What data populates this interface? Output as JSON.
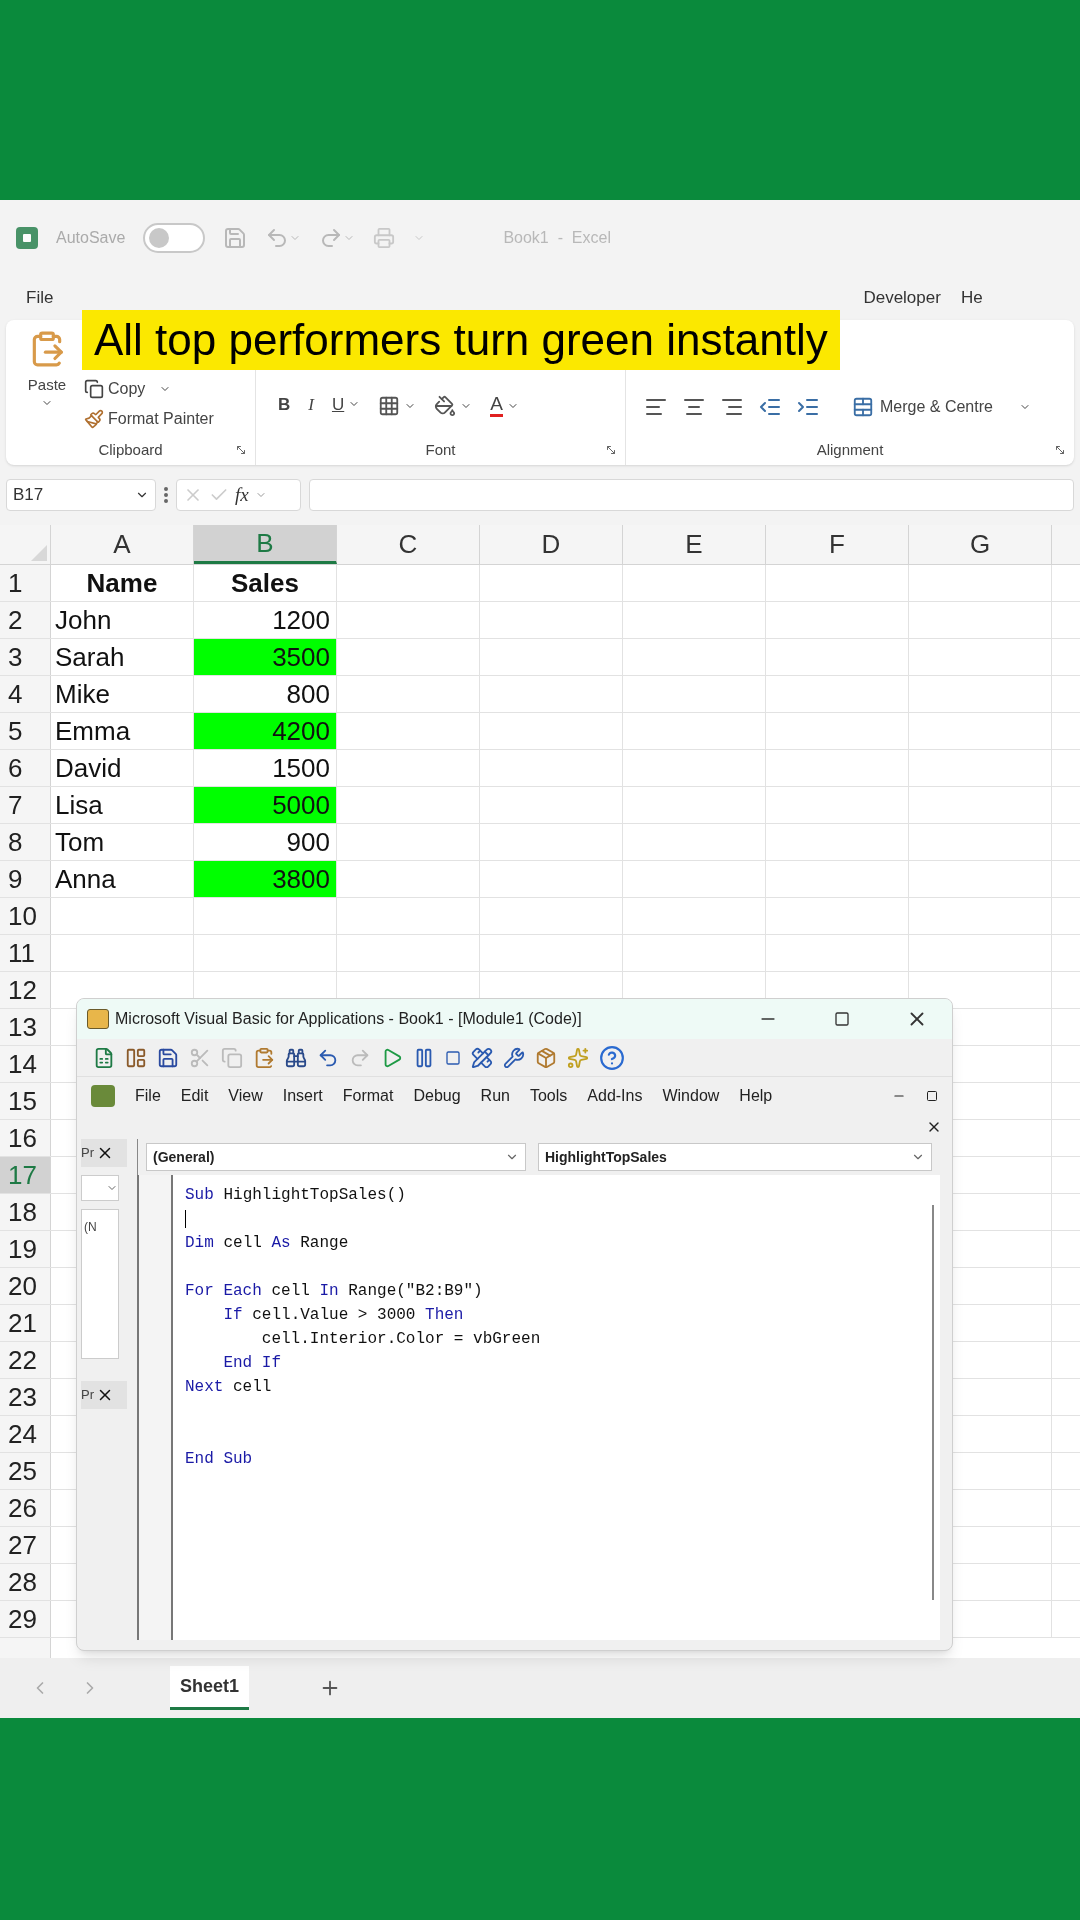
{
  "excel": {
    "app_title": "Book1  -  Excel",
    "autosave": {
      "label": "AutoSave",
      "on": false
    },
    "tabs": [
      "File",
      "Developer",
      "He"
    ],
    "caption": "All top performers turn green instantly",
    "ribbon": {
      "clipboard": {
        "paste": "Paste",
        "copy": "Copy",
        "format_painter": "Format Painter",
        "label": "Clipboard"
      },
      "font": {
        "bold": "B",
        "italic": "I",
        "underline": "U",
        "font_color": "A",
        "label": "Font"
      },
      "alignment": {
        "merge": "Merge & Centre",
        "label": "Alignment"
      }
    },
    "formula_bar": {
      "name_box": "B17",
      "fx": "fx"
    },
    "columns": [
      {
        "label": "A",
        "selected": false
      },
      {
        "label": "B",
        "selected": true
      },
      {
        "label": "C",
        "selected": false
      },
      {
        "label": "D",
        "selected": false
      },
      {
        "label": "E",
        "selected": false
      },
      {
        "label": "F",
        "selected": false
      },
      {
        "label": "G",
        "selected": false
      }
    ],
    "row_numbers": [
      {
        "label": "1",
        "selected": false
      },
      {
        "label": "2",
        "selected": false
      },
      {
        "label": "3",
        "selected": false
      },
      {
        "label": "4",
        "selected": false
      },
      {
        "label": "5",
        "selected": false
      },
      {
        "label": "6",
        "selected": false
      },
      {
        "label": "7",
        "selected": false
      },
      {
        "label": "8",
        "selected": false
      },
      {
        "label": "9",
        "selected": false
      },
      {
        "label": "10",
        "selected": false
      },
      {
        "label": "11",
        "selected": false
      },
      {
        "label": "12",
        "selected": false
      },
      {
        "label": "13",
        "selected": false
      },
      {
        "label": "14",
        "selected": false
      },
      {
        "label": "15",
        "selected": false
      },
      {
        "label": "16",
        "selected": false
      },
      {
        "label": "17",
        "selected": true
      },
      {
        "label": "18",
        "selected": false
      },
      {
        "label": "19",
        "selected": false
      },
      {
        "label": "20",
        "selected": false
      },
      {
        "label": "21",
        "selected": false
      },
      {
        "label": "22",
        "selected": false
      },
      {
        "label": "23",
        "selected": false
      },
      {
        "label": "24",
        "selected": false
      },
      {
        "label": "25",
        "selected": false
      },
      {
        "label": "26",
        "selected": false
      },
      {
        "label": "27",
        "selected": false
      },
      {
        "label": "28",
        "selected": false
      },
      {
        "label": "29",
        "selected": false
      }
    ],
    "table": {
      "header": [
        "Name",
        "Sales"
      ],
      "rows": [
        {
          "name": "John",
          "sales": "1200",
          "highlighted": false
        },
        {
          "name": "Sarah",
          "sales": "3500",
          "highlighted": true
        },
        {
          "name": "Mike",
          "sales": "800",
          "highlighted": false
        },
        {
          "name": "Emma",
          "sales": "4200",
          "highlighted": true
        },
        {
          "name": "David",
          "sales": "1500",
          "highlighted": false
        },
        {
          "name": "Lisa",
          "sales": "5000",
          "highlighted": true
        },
        {
          "name": "Tom",
          "sales": "900",
          "highlighted": false
        },
        {
          "name": "Anna",
          "sales": "3800",
          "highlighted": true
        }
      ]
    },
    "sheets": [
      {
        "label": "Sheet1",
        "selected": true
      }
    ]
  },
  "vba": {
    "title": "Microsoft Visual Basic for Applications - Book1 - [Module1 (Code)]",
    "menu": [
      "File",
      "Edit",
      "View",
      "Insert",
      "Format",
      "Debug",
      "Run",
      "Tools",
      "Add-Ins",
      "Window",
      "Help"
    ],
    "project_pane": {
      "title": "Pr",
      "list_item": "(N"
    },
    "properties_pane": {
      "title": "Pr"
    },
    "object_dropdown": "(General)",
    "procedure_dropdown": "HighlightTopSales",
    "code": [
      {
        "kind": "code",
        "tokens": [
          {
            "text": "Sub",
            "keyword": true
          },
          {
            "text": "HighlightTopSales()",
            "keyword": false
          }
        ]
      },
      {
        "kind": "cursor"
      },
      {
        "kind": "code",
        "tokens": [
          {
            "text": "Dim",
            "keyword": true
          },
          {
            "text": "cell",
            "keyword": false
          },
          {
            "text": "As",
            "keyword": true
          },
          {
            "text": "Range",
            "keyword": false
          }
        ]
      },
      {
        "kind": "blank"
      },
      {
        "kind": "code",
        "tokens": [
          {
            "text": "For Each",
            "keyword": true
          },
          {
            "text": "cell",
            "keyword": false
          },
          {
            "text": "In",
            "keyword": true
          },
          {
            "text": "Range(\"B2:B9\")",
            "keyword": false
          }
        ]
      },
      {
        "kind": "code",
        "tokens": [
          {
            "text": "    If",
            "keyword": true
          },
          {
            "text": "cell.Value > 3000",
            "keyword": false
          },
          {
            "text": "Then",
            "keyword": true
          }
        ]
      },
      {
        "kind": "code",
        "tokens": [
          {
            "text": "        cell.Interior.Color = vbGreen",
            "keyword": false
          }
        ]
      },
      {
        "kind": "code",
        "tokens": [
          {
            "text": "    End If",
            "keyword": true
          }
        ]
      },
      {
        "kind": "code",
        "tokens": [
          {
            "text": "Next",
            "keyword": true
          },
          {
            "text": "cell",
            "keyword": false
          }
        ]
      },
      {
        "kind": "blank"
      },
      {
        "kind": "blank"
      },
      {
        "kind": "code",
        "tokens": [
          {
            "text": "End Sub",
            "keyword": true
          }
        ]
      }
    ]
  }
}
